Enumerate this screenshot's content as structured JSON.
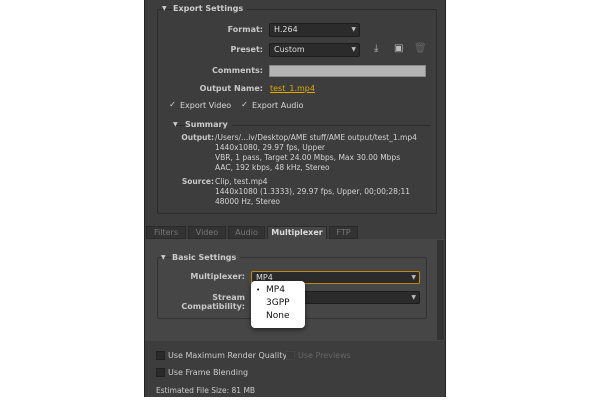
{
  "export_settings": {
    "title": "Export Settings",
    "format_label": "Format:",
    "format_value": "H.264",
    "preset_label": "Preset:",
    "preset_value": "Custom",
    "comments_label": "Comments:",
    "comments_value": "",
    "output_name_label": "Output Name:",
    "output_name_value": "test_1.mp4",
    "export_video": "Export Video",
    "export_audio": "Export Audio"
  },
  "summary": {
    "title": "Summary",
    "output_label": "Output:",
    "output_lines": [
      "/Users/...iv/Desktop/AME stuff/AME output/test_1.mp4",
      "1440x1080, 29.97 fps, Upper",
      "VBR, 1 pass, Target 24.00 Mbps, Max 30.00 Mbps",
      "AAC, 192 kbps, 48 kHz, Stereo"
    ],
    "source_label": "Source:",
    "source_lines": [
      "Clip, test.mp4",
      "1440x1080 (1.3333), 29.97 fps, Upper, 00;00;28;11",
      "48000 Hz, Stereo"
    ]
  },
  "tabs": [
    "Filters",
    "Video",
    "Audio",
    "Multiplexer",
    "FTP"
  ],
  "basic": {
    "title": "Basic Settings",
    "multiplexer_label": "Multiplexer:",
    "multiplexer_value": "MP4",
    "stream_label": "Stream Compatibility:",
    "options": [
      "MP4",
      "3GPP",
      "None"
    ]
  },
  "footer": {
    "max_quality": "Use Maximum Render Quality",
    "use_previews": "Use Previews",
    "frame_blending": "Use Frame Blending",
    "est_label": "Estimated File Size:",
    "est_value": "81 MB"
  },
  "colors": {
    "accent": "#e0a800"
  }
}
